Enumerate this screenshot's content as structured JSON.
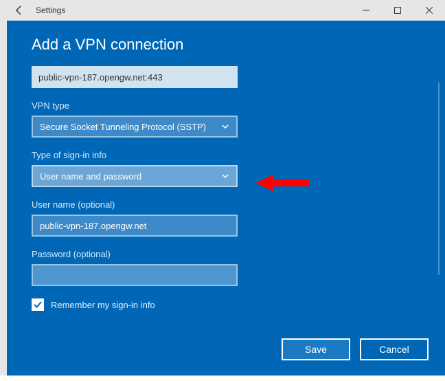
{
  "window": {
    "title": "Settings"
  },
  "dialog": {
    "heading": "Add a VPN connection",
    "server_value": "public-vpn-187.opengw.net:443",
    "vpn_type_label": "VPN type",
    "vpn_type_value": "Secure Socket Tunneling Protocol (SSTP)",
    "signin_type_label": "Type of sign-in info",
    "signin_type_value": "User name and password",
    "username_label": "User name (optional)",
    "username_value": "public-vpn-187.opengw.net",
    "password_label": "Password (optional)",
    "password_value": "",
    "remember_label": "Remember my sign-in info",
    "remember_checked": true,
    "save_label": "Save",
    "cancel_label": "Cancel"
  },
  "annotation": {
    "arrow_target": "signin-type-dropdown"
  }
}
